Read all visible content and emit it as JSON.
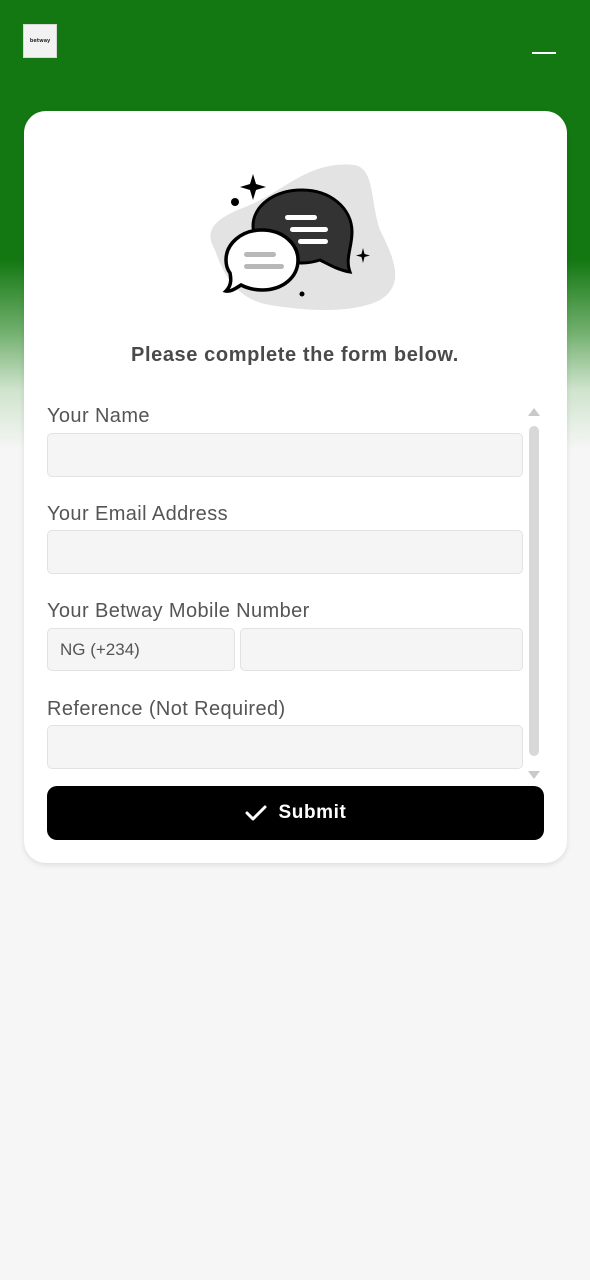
{
  "header": {
    "logo_text": "betway",
    "menu_icon": "hamburger-menu-icon",
    "brand_color": "#137812"
  },
  "form": {
    "illustration_icon": "chat-bubbles-icon",
    "prompt": "Please complete the form below.",
    "name": {
      "label": "Your Name",
      "value": ""
    },
    "email": {
      "label": "Your Email Address",
      "value": ""
    },
    "mobile": {
      "label": "Your Betway Mobile Number",
      "country_code": "NG (+234)",
      "value": ""
    },
    "reference": {
      "label": "Reference (Not Required)",
      "value": ""
    },
    "submit": {
      "label": "Submit",
      "icon": "checkmark-icon",
      "color": "#000000"
    }
  }
}
